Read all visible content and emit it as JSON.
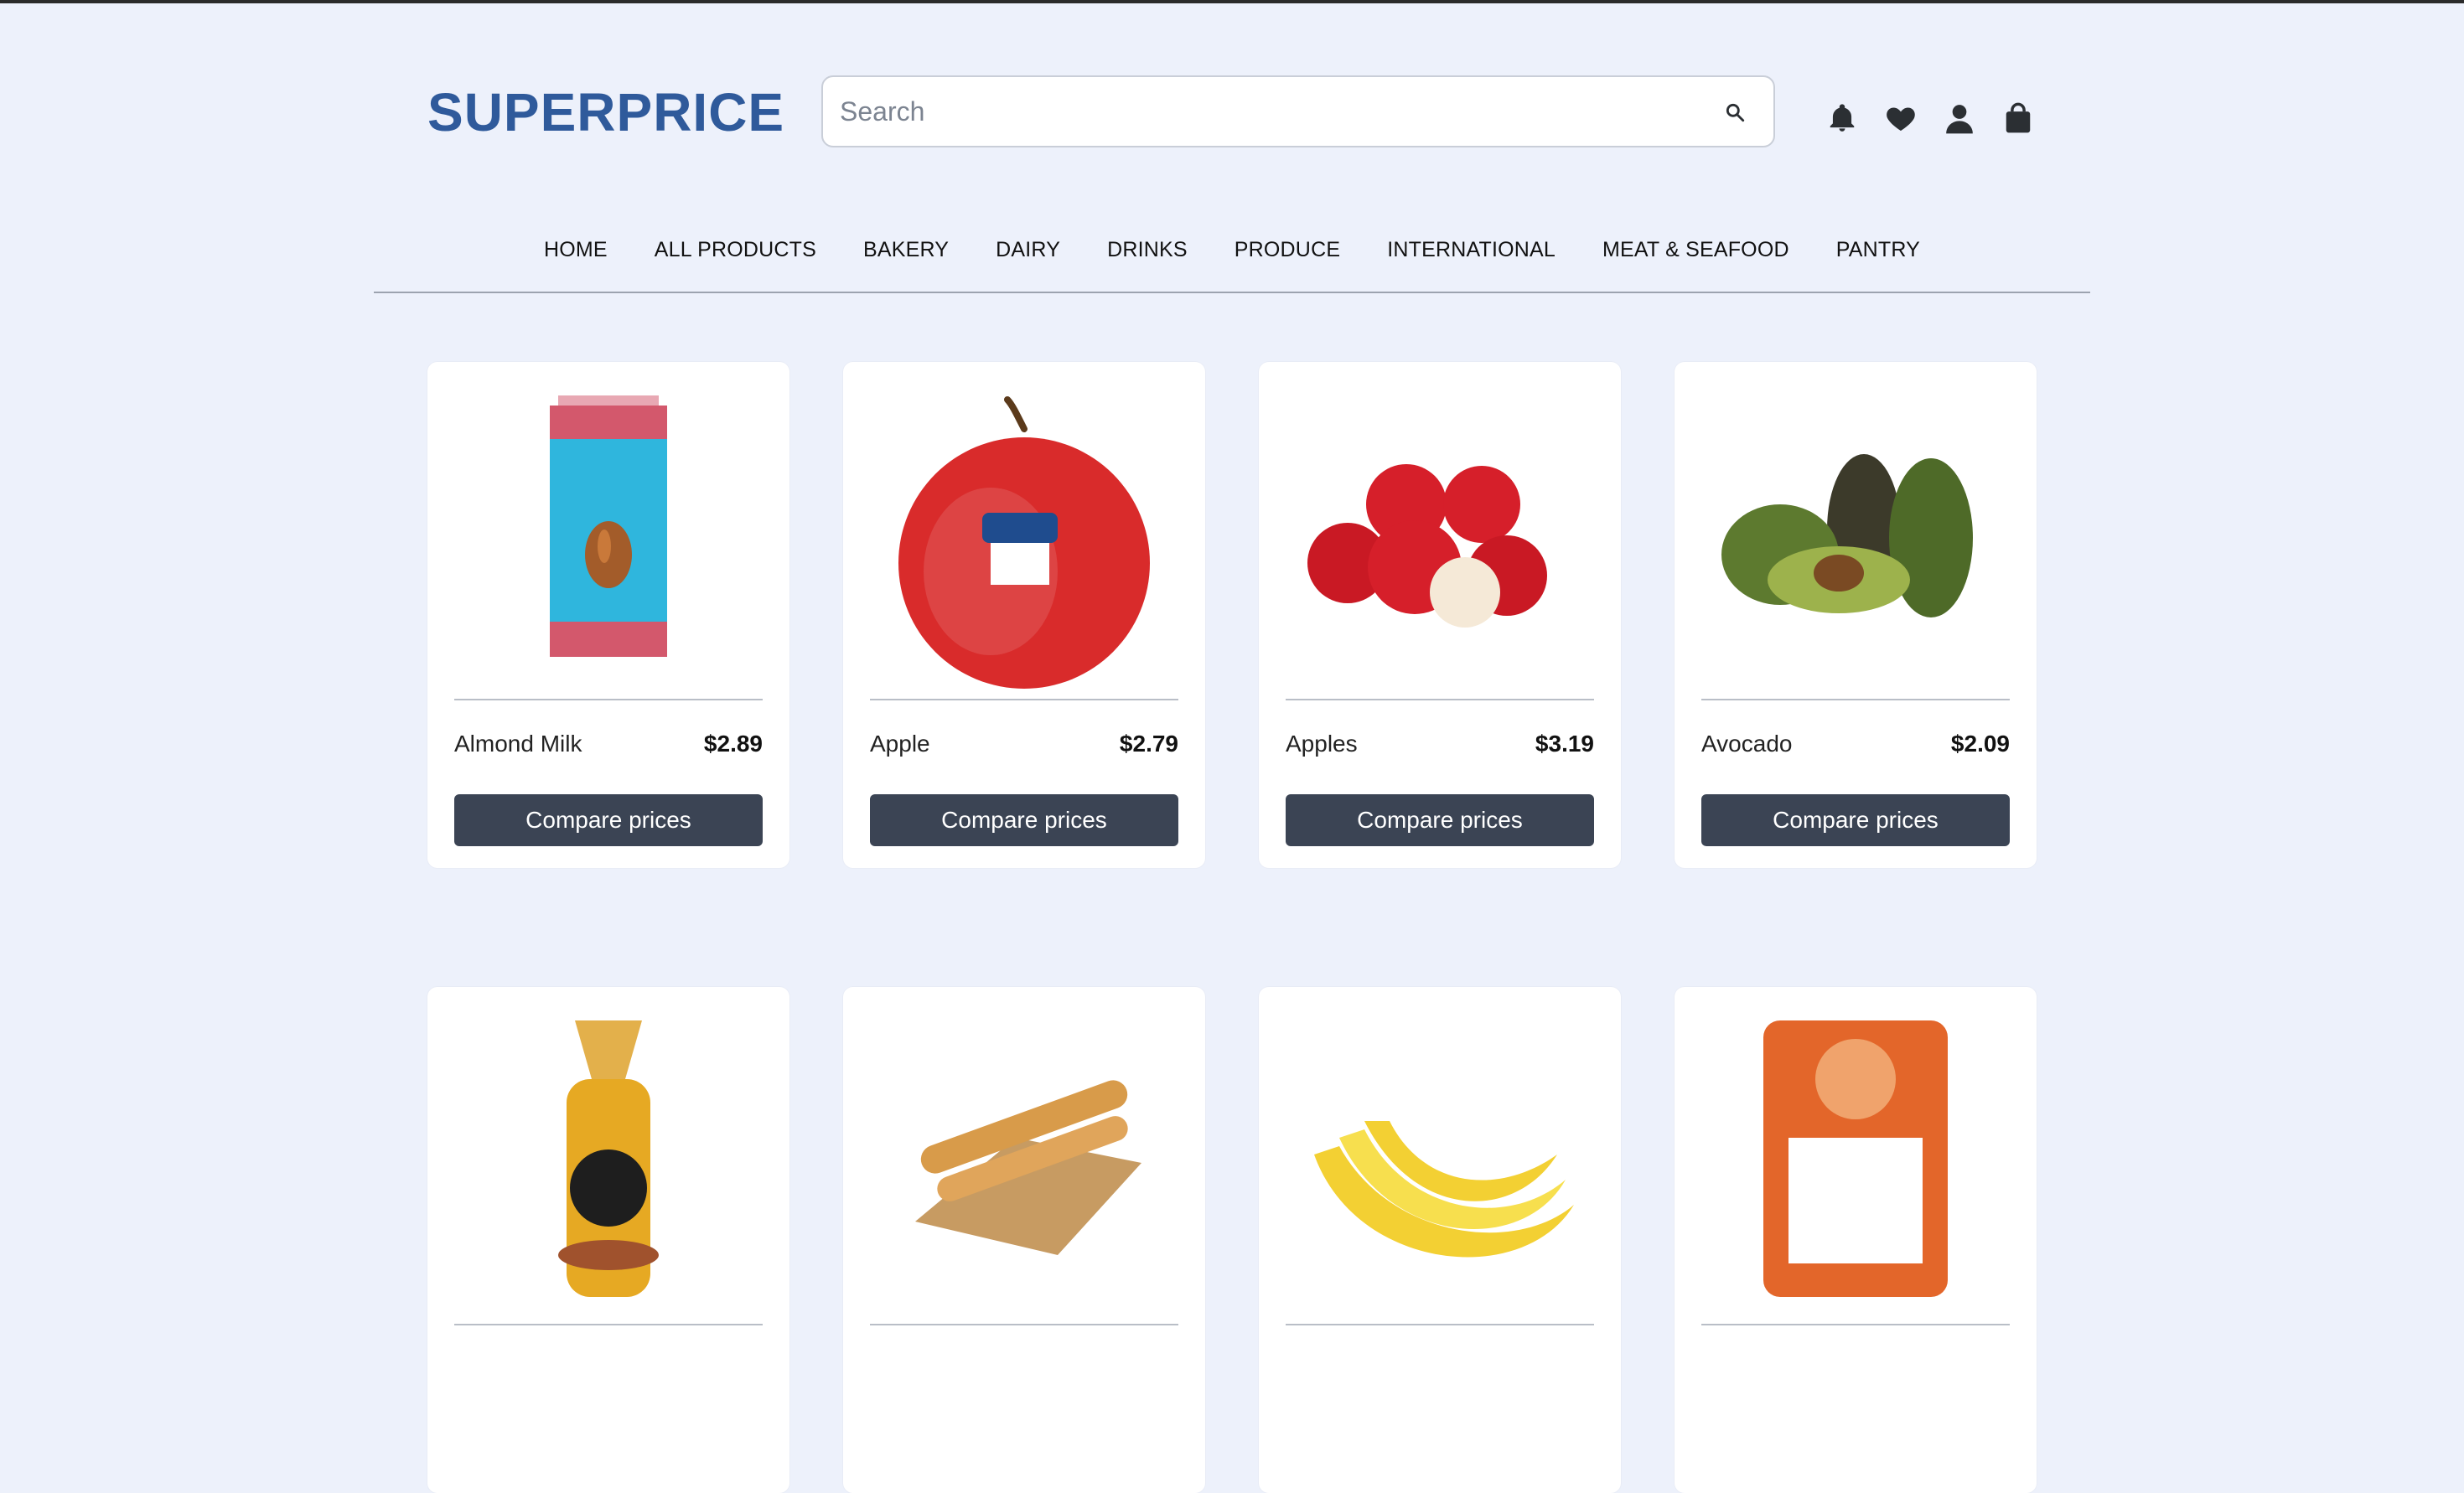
{
  "brand": {
    "name": "SUPERPRICE",
    "color": "#2F5A9B"
  },
  "search": {
    "placeholder": "Search",
    "icon": "search-icon"
  },
  "header_icons": [
    {
      "name": "bell-icon"
    },
    {
      "name": "heart-icon"
    },
    {
      "name": "user-icon"
    },
    {
      "name": "shopping-bag-icon"
    }
  ],
  "nav": {
    "items": [
      {
        "label": "HOME"
      },
      {
        "label": "ALL PRODUCTS"
      },
      {
        "label": "BAKERY"
      },
      {
        "label": "DAIRY"
      },
      {
        "label": "DRINKS"
      },
      {
        "label": "PRODUCE"
      },
      {
        "label": "INTERNATIONAL"
      },
      {
        "label": "MEAT & SEAFOOD"
      },
      {
        "label": "PANTRY"
      }
    ]
  },
  "products": [
    {
      "name": "Almond Milk",
      "price": "$2.89",
      "button": "Compare prices",
      "image": "almond-milk-carton"
    },
    {
      "name": "Apple",
      "price": "$2.79",
      "button": "Compare prices",
      "image": "red-apple"
    },
    {
      "name": "Apples",
      "price": "$3.19",
      "button": "Compare prices",
      "image": "apples-pile"
    },
    {
      "name": "Avocado",
      "price": "$2.09",
      "button": "Compare prices",
      "image": "avocados"
    },
    {
      "name": "",
      "price": "",
      "button": "",
      "image": "bagels-bag"
    },
    {
      "name": "",
      "price": "",
      "button": "",
      "image": "baguette"
    },
    {
      "name": "",
      "price": "",
      "button": "",
      "image": "bananas"
    },
    {
      "name": "",
      "price": "",
      "button": "",
      "image": "basmati-rice-bag"
    }
  ],
  "colors": {
    "background": "#EDF1FB",
    "button": "#3B4454",
    "icon": "#2B2F33"
  }
}
